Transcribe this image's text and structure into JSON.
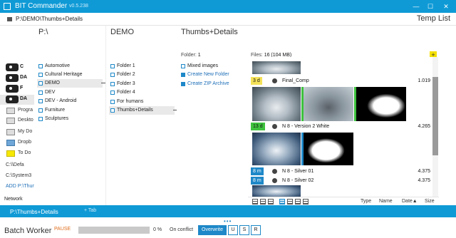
{
  "titlebar": {
    "app_name": "BIT Commander",
    "version": "v0.5.238",
    "minimize": "—",
    "maximize": "☐",
    "close": "✕"
  },
  "pathbar": {
    "path": "P:\\DEMO\\Thumbs+Details",
    "temp_list": "Temp List"
  },
  "drives": [
    {
      "label": "C"
    },
    {
      "label": "DA"
    },
    {
      "label": "F"
    },
    {
      "label": "DA"
    }
  ],
  "favorites": [
    {
      "label": "Progra",
      "icon": "folder-icon"
    },
    {
      "label": "Deskto",
      "icon": "desktop-icon"
    },
    {
      "label": "My Do",
      "icon": "documents-icon"
    },
    {
      "label": "Dropb",
      "icon": "dropbox-icon"
    },
    {
      "label": "To Do",
      "icon": "todo-icon"
    }
  ],
  "recent_paths": [
    "C:\\\\Defa",
    "C:\\System3",
    "ADD P:\\Thum"
  ],
  "network_label": "Network",
  "columns": {
    "p": {
      "header": "P:\\",
      "items": [
        "Automotive",
        "Cultural Heritage",
        "DEMO",
        "DEV",
        "DEV - Android",
        "Furniture",
        "Sculptures"
      ],
      "selected": "DEMO"
    },
    "demo": {
      "header": "DEMO",
      "items": [
        "Folder 1",
        "Folder 2",
        "Folder 3",
        "Folder 4",
        "For humans",
        "Thumbs+Details"
      ],
      "selected": "Thumbs+Details"
    },
    "thumbs": {
      "header": "Thumbs+Details",
      "folder_label": "Folder:",
      "folder_count": "1",
      "items": [
        "Mixed images"
      ],
      "actions": [
        "Create New Folder",
        "Create ZIP Archive"
      ]
    }
  },
  "files": {
    "label": "Files:",
    "count": "16 (104 MB)",
    "add_button": "+",
    "rows": [
      {
        "age": "3 d",
        "name": "Final_Comp",
        "size": "1.019",
        "color": "#f4e25a"
      },
      {
        "age": "13 d",
        "name": "N 8 - Version 2 White",
        "size": "4.265",
        "color": "#3ec23e"
      },
      {
        "age": "8 m",
        "name": "N 8 - Silver 01",
        "size": "4.375",
        "color": "#1e88c8"
      },
      {
        "age": "8 m",
        "name": "N 8 - Silver 02",
        "size": "4.375",
        "color": "#1e88c8"
      }
    ]
  },
  "sortbar": {
    "type": "Type",
    "name": "Name",
    "date": "Date▲",
    "size": "Size"
  },
  "tabs": {
    "active": "P:\\Thumbs+Details",
    "add": "+ Tab"
  },
  "batch": {
    "title": "Batch Worker",
    "pause": "PAUSE",
    "progress_percent": 0,
    "progress_text": "0 %",
    "on_conflict": "On conflict",
    "options": [
      "Overwrite",
      "U",
      "S",
      "R"
    ],
    "selected_option": "Overwrite"
  },
  "colors": {
    "accent": "#0f9ad6",
    "highlight": "#1e88c8",
    "recent": "#3ec23e",
    "warning": "#e06d1c"
  }
}
